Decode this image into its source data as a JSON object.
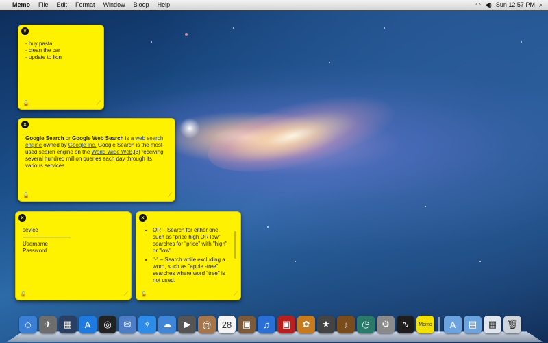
{
  "menubar": {
    "apple": "",
    "app_name": "Memo",
    "menus": [
      "File",
      "Edit",
      "Format",
      "Window",
      "Bloop",
      "Help"
    ],
    "clock": "Sun 12:57 PM"
  },
  "notes": {
    "note1": {
      "lines": [
        "- buy pasta",
        "- clean the car",
        "- update to lion"
      ]
    },
    "note2": {
      "t1": "Google Search",
      "t2": " or ",
      "t3": "Google Web Search",
      "t4": " is a ",
      "link1": "web search engine",
      "t5": " owned by ",
      "link2": "Google Inc.",
      "t6": " Google Search is the most-used search engine on the ",
      "link3": "World Wide Web",
      "t7": ".[3] receiving several hundred million queries each day through its various services"
    },
    "note3": {
      "lines": [
        "sevice",
        "------------------------------------------",
        "Username",
        "Password"
      ]
    },
    "note4": {
      "item1": "OR – Search for either one, such as \"price high OR low\" searches for \"price\" with \"high\" or \"low\".",
      "item2": "\"-\" – Search while excluding a word, such as \"apple -tree\" searches where word \"tree\" is not used."
    }
  },
  "dock": {
    "apps": [
      {
        "icon": "finder-icon",
        "color": "#3a7fd5",
        "glyph": "☺"
      },
      {
        "icon": "launchpad-icon",
        "color": "#6d6d6d",
        "glyph": "✈"
      },
      {
        "icon": "mission-control-icon",
        "color": "#2b3f63",
        "glyph": "▦"
      },
      {
        "icon": "app-store-icon",
        "color": "#1f7ae0",
        "glyph": "A"
      },
      {
        "icon": "dashboard-icon",
        "color": "#222222",
        "glyph": "◎"
      },
      {
        "icon": "preview-icon",
        "color": "#4d7cc4",
        "glyph": "✉"
      },
      {
        "icon": "safari-icon",
        "color": "#2d8ce8",
        "glyph": "✧"
      },
      {
        "icon": "ichat-icon",
        "color": "#3f86d9",
        "glyph": "☁"
      },
      {
        "icon": "facetime-icon",
        "color": "#555555",
        "glyph": "▶"
      },
      {
        "icon": "address-book-icon",
        "color": "#a6754a",
        "glyph": "@"
      },
      {
        "icon": "ical-icon",
        "color": "#f3f3f3",
        "glyph": "28"
      },
      {
        "icon": "photo-booth-icon",
        "color": "#7a5a3a",
        "glyph": "▣"
      },
      {
        "icon": "itunes-icon",
        "color": "#2a6fd6",
        "glyph": "♫"
      },
      {
        "icon": "photo-booth-red-icon",
        "color": "#b82020",
        "glyph": "▣"
      },
      {
        "icon": "iphoto-icon",
        "color": "#c77b1c",
        "glyph": "✿"
      },
      {
        "icon": "imovie-icon",
        "color": "#444444",
        "glyph": "★"
      },
      {
        "icon": "garageband-icon",
        "color": "#7a4c1c",
        "glyph": "♪"
      },
      {
        "icon": "time-machine-icon",
        "color": "#2a7a6a",
        "glyph": "◷"
      },
      {
        "icon": "system-preferences-icon",
        "color": "#8a8a8a",
        "glyph": "⚙"
      },
      {
        "icon": "activity-monitor-icon",
        "color": "#1d1d1d",
        "glyph": "∿"
      },
      {
        "icon": "memo-icon",
        "color": "#f2e100",
        "glyph": "Memo"
      }
    ],
    "folders": [
      {
        "icon": "applications-folder-icon",
        "color": "#6aa3dd",
        "glyph": "A"
      },
      {
        "icon": "documents-folder-icon",
        "color": "#6aa3dd",
        "glyph": "▤"
      },
      {
        "icon": "downloads-stack-icon",
        "color": "#dfe6ef",
        "glyph": "▦"
      },
      {
        "icon": "trash-icon",
        "color": "#cfd4da",
        "glyph": "🗑"
      }
    ]
  }
}
